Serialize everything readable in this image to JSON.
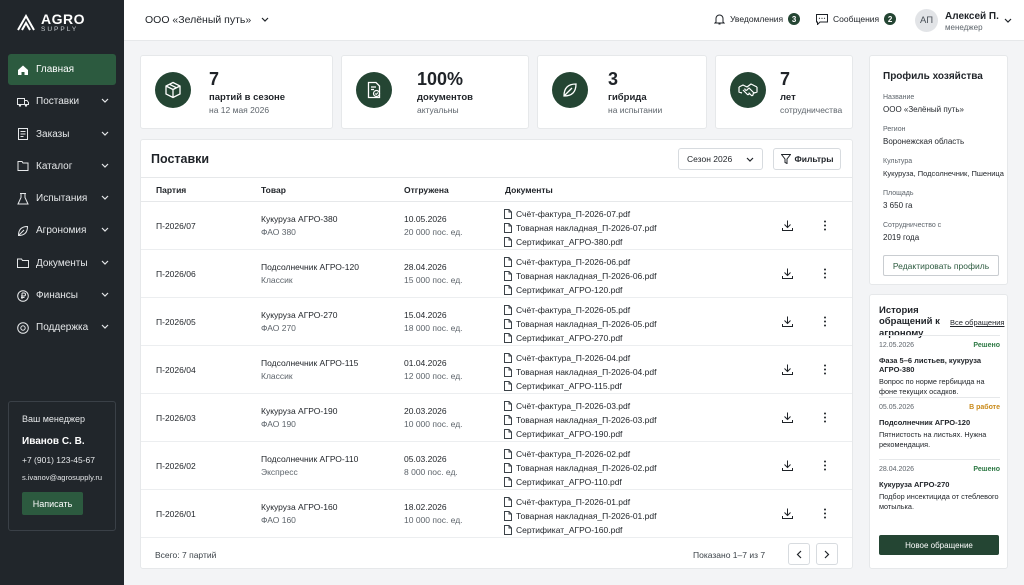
{
  "brand": {
    "name": "AGRO",
    "sub": "SUPPLY"
  },
  "sidebar": {
    "items": [
      {
        "label": "Главная"
      },
      {
        "label": "Поставки"
      },
      {
        "label": "Заказы"
      },
      {
        "label": "Каталог"
      },
      {
        "label": "Испытания"
      },
      {
        "label": "Агрономия"
      },
      {
        "label": "Документы"
      },
      {
        "label": "Финансы"
      },
      {
        "label": "Поддержка"
      }
    ],
    "manager": {
      "title": "Ваш менеджер",
      "name": "Иванов С. В.",
      "phone": "+7 (901) 123-45-67",
      "email": "s.ivanov@agrosupply.ru",
      "button": "Написать"
    }
  },
  "topbar": {
    "company": "ООО «Зелёный путь»",
    "notifications": {
      "label": "Уведомления",
      "count": "3"
    },
    "messages": {
      "label": "Сообщения",
      "count": "2"
    },
    "user": {
      "initials": "АП",
      "name": "Алексей П.",
      "role": "менеджер"
    }
  },
  "stats": [
    {
      "value": "7",
      "label": "партий в сезоне",
      "sub": "на 12 мая 2026"
    },
    {
      "value": "100%",
      "label": "документов",
      "sub": "актуальны"
    },
    {
      "value": "3",
      "label": "гибрида",
      "sub": "на испытании"
    },
    {
      "value": "7",
      "label": "лет",
      "sub": "сотрудничества"
    }
  ],
  "deliveries": {
    "title": "Поставки",
    "season": "Сезон 2026",
    "filters": "Фильтры",
    "columns": [
      "Партия",
      "Товар",
      "Отгружена",
      "Документы"
    ],
    "rows": [
      {
        "batch": "П-2026/07",
        "product": "Кукуруза АГРО-380",
        "variant": "ФАО 380",
        "date": "10.05.2026",
        "qty": "20 000 пос. ед.",
        "docs": [
          "Счёт-фактура_П-2026-07.pdf",
          "Товарная накладная_П-2026-07.pdf",
          "Сертификат_АГРО-380.pdf"
        ]
      },
      {
        "batch": "П-2026/06",
        "product": "Подсолнечник АГРО-120",
        "variant": "Классик",
        "date": "28.04.2026",
        "qty": "15 000 пос. ед.",
        "docs": [
          "Счёт-фактура_П-2026-06.pdf",
          "Товарная накладная_П-2026-06.pdf",
          "Сертификат_АГРО-120.pdf"
        ]
      },
      {
        "batch": "П-2026/05",
        "product": "Кукуруза АГРО-270",
        "variant": "ФАО 270",
        "date": "15.04.2026",
        "qty": "18 000 пос. ед.",
        "docs": [
          "Счёт-фактура_П-2026-05.pdf",
          "Товарная накладная_П-2026-05.pdf",
          "Сертификат_АГРО-270.pdf"
        ]
      },
      {
        "batch": "П-2026/04",
        "product": "Подсолнечник АГРО-115",
        "variant": "Классик",
        "date": "01.04.2026",
        "qty": "12 000 пос. ед.",
        "docs": [
          "Счёт-фактура_П-2026-04.pdf",
          "Товарная накладная_П-2026-04.pdf",
          "Сертификат_АГРО-115.pdf"
        ]
      },
      {
        "batch": "П-2026/03",
        "product": "Кукуруза АГРО-190",
        "variant": "ФАО 190",
        "date": "20.03.2026",
        "qty": "10 000 пос. ед.",
        "docs": [
          "Счёт-фактура_П-2026-03.pdf",
          "Товарная накладная_П-2026-03.pdf",
          "Сертификат_АГРО-190.pdf"
        ]
      },
      {
        "batch": "П-2026/02",
        "product": "Подсолнечник АГРО-110",
        "variant": "Экспресс",
        "date": "05.03.2026",
        "qty": "8 000 пос. ед.",
        "docs": [
          "Счёт-фактура_П-2026-02.pdf",
          "Товарная накладная_П-2026-02.pdf",
          "Сертификат_АГРО-110.pdf"
        ]
      },
      {
        "batch": "П-2026/01",
        "product": "Кукуруза АГРО-160",
        "variant": "ФАО 160",
        "date": "18.02.2026",
        "qty": "10 000 пос. ед.",
        "docs": [
          "Счёт-фактура_П-2026-01.pdf",
          "Товарная накладная_П-2026-01.pdf",
          "Сертификат_АГРО-160.pdf"
        ]
      }
    ],
    "total": "Всего: 7 партий",
    "shown": "Показано 1–7 из 7"
  },
  "profile": {
    "title": "Профиль хозяйства",
    "fields": [
      {
        "label": "Название",
        "value": "ООО «Зелёный путь»"
      },
      {
        "label": "Регион",
        "value": "Воронежская область"
      },
      {
        "label": "Культура",
        "value": "Кукуруза, Подсолнечник, Пшеница"
      },
      {
        "label": "Площадь",
        "value": "3 650 га"
      },
      {
        "label": "Сотрудничество с",
        "value": "2019 года"
      }
    ],
    "edit": "Редактировать профиль"
  },
  "history": {
    "title": "История обращений к агроному",
    "all": "Все обращения",
    "items": [
      {
        "date": "12.05.2026",
        "status": "Решено",
        "status_color": "#2f7a46",
        "title": "Фаза 5–6 листьев, кукуруза АГРО-380",
        "text": "Вопрос по норме гербицида на фоне текущих осадков."
      },
      {
        "date": "05.05.2026",
        "status": "В работе",
        "status_color": "#c98a1a",
        "title": "Подсолнечник АГРО-120",
        "text": "Пятнистость на листьях. Нужна рекомендация."
      },
      {
        "date": "28.04.2026",
        "status": "Решено",
        "status_color": "#2f7a46",
        "title": "Кукуруза АГРО-270",
        "text": "Подбор инсектицида от стеблевого мотылька."
      }
    ],
    "new": "Новое обращение"
  },
  "colors": {
    "accent": "#244533",
    "sidebar": "#21262b"
  }
}
